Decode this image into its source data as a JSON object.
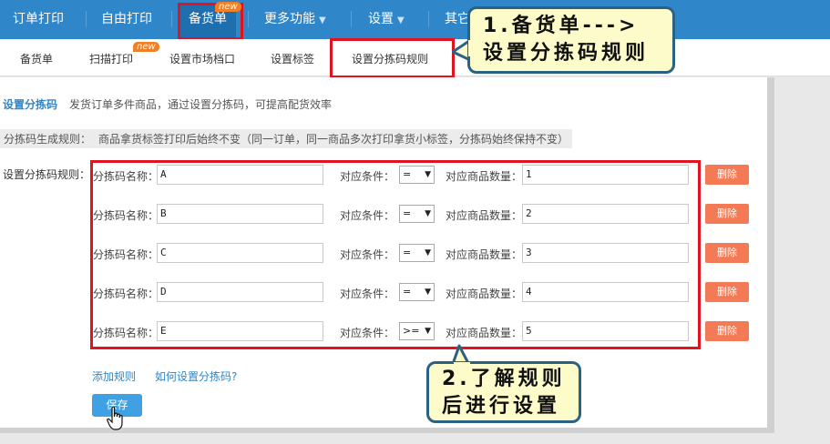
{
  "topnav": {
    "items": [
      "订单打印",
      "自由打印",
      "备货单",
      "更多功能",
      "设置",
      "其它"
    ],
    "new_badge": "new",
    "dropdown_glyph": "▼"
  },
  "subnav": {
    "tabs": [
      "备货单",
      "扫描打印",
      "设置市场档口",
      "设置标签",
      "设置分拣码规则"
    ],
    "new_badge": "new"
  },
  "page": {
    "title": "设置分拣码",
    "description": "发货订单多件商品，通过设置分拣码，可提高配货效率",
    "rule_note_label": "分拣码生成规则：",
    "rule_note_text": "商品拿货标签打印后始终不变（同一订单，同一商品多次打印拿货小标签，分拣码始终保持不变）",
    "rules_label": "设置分拣码规则："
  },
  "rules": [
    {
      "name_label": "分拣码名称：",
      "name": "A",
      "cond_label": "对应条件：",
      "cond": "=",
      "qty_label": "对应商品数量：",
      "qty": "1",
      "delete": "删除"
    },
    {
      "name_label": "分拣码名称：",
      "name": "B",
      "cond_label": "对应条件：",
      "cond": "=",
      "qty_label": "对应商品数量：",
      "qty": "2",
      "delete": "删除"
    },
    {
      "name_label": "分拣码名称：",
      "name": "C",
      "cond_label": "对应条件：",
      "cond": "=",
      "qty_label": "对应商品数量：",
      "qty": "3",
      "delete": "删除"
    },
    {
      "name_label": "分拣码名称：",
      "name": "D",
      "cond_label": "对应条件：",
      "cond": "=",
      "qty_label": "对应商品数量：",
      "qty": "4",
      "delete": "删除"
    },
    {
      "name_label": "分拣码名称：",
      "name": "E",
      "cond_label": "对应条件：",
      "cond": ">=",
      "qty_label": "对应商品数量：",
      "qty": "5",
      "delete": "删除"
    }
  ],
  "actions": {
    "add_rule": "添加规则",
    "how_to": "如何设置分拣码?",
    "save": "保存"
  },
  "callouts": {
    "c1_line1": "1.备货单--->",
    "c1_line2": "设置分拣码规则",
    "c2_line1": "2.了解规则",
    "c2_line2": "后进行设置"
  },
  "colors": {
    "nav_blue": "#2f86c8",
    "highlight_red": "#e0141e",
    "delete_orange": "#f47a55",
    "callout_yellow": "#fdfbc9"
  }
}
